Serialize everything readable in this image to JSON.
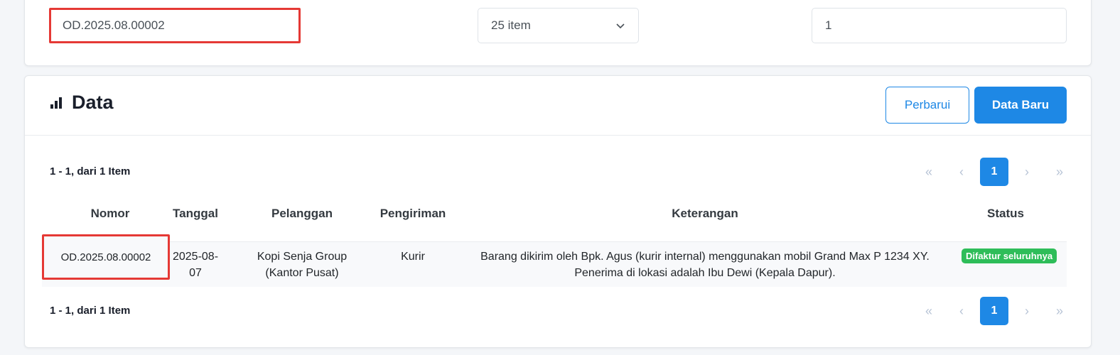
{
  "filter": {
    "search_value": "OD.2025.08.00002",
    "per_page_selected": "25 item",
    "page_value": "1"
  },
  "data_card": {
    "title": "Data",
    "refresh_label": "Perbarui",
    "new_label": "Data Baru",
    "count_text": "1 - 1, dari 1 Item"
  },
  "pagination": {
    "first": "«",
    "prev": "‹",
    "current": "1",
    "next": "›",
    "last": "»"
  },
  "table": {
    "headers": [
      "Nomor",
      "Tanggal",
      "Pelanggan",
      "Pengiriman",
      "Keterangan",
      "Status"
    ],
    "rows": [
      {
        "nomor": "OD.2025.08.00002",
        "tanggal_line1": "2025-08-",
        "tanggal_line2": "07",
        "pelanggan_line1": "Kopi Senja Group",
        "pelanggan_line2": "(Kantor Pusat)",
        "pengiriman": "Kurir",
        "keterangan_line1": "Barang dikirim oleh Bpk. Agus (kurir internal) menggunakan mobil Grand Max P 1234 XY.",
        "keterangan_line2": "Penerima di lokasi adalah Ibu Dewi (Kepala Dapur).",
        "status": "Difaktur seluruhnya"
      }
    ]
  },
  "colors": {
    "primary": "#1e88e5",
    "highlight_border": "#e53935",
    "status_success": "#2ebd59"
  },
  "icons": {
    "data_title_icon": "bar-chart-icon",
    "select_icon": "chevron-down-icon"
  }
}
